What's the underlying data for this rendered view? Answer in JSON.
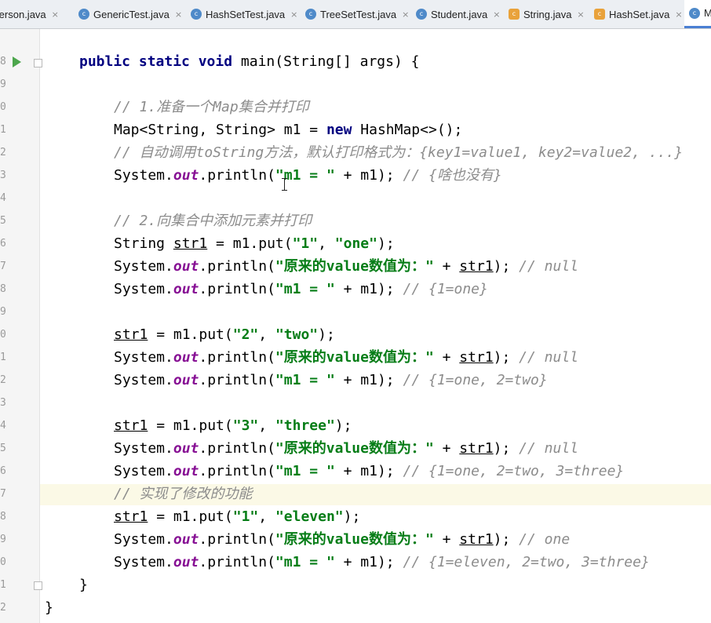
{
  "tabs": [
    {
      "label": "Person.java",
      "icon": "class-icon"
    },
    {
      "label": "GenericTest.java",
      "icon": "class-icon"
    },
    {
      "label": "HashSetTest.java",
      "icon": "class-icon"
    },
    {
      "label": "TreeSetTest.java",
      "icon": "class-icon"
    },
    {
      "label": "Student.java",
      "icon": "class-icon"
    },
    {
      "label": "String.java",
      "icon": "library-class-icon"
    },
    {
      "label": "HashSet.java",
      "icon": "library-class-icon"
    },
    {
      "label": "M",
      "icon": "class-icon",
      "active": true
    }
  ],
  "tab_close_glyph": "×",
  "line_numbers": [
    "8",
    "9",
    "0",
    "1",
    "2",
    "3",
    "4",
    "5",
    "6",
    "7",
    "8",
    "9",
    "0",
    "1",
    "2",
    "3",
    "4",
    "5",
    "6",
    "7",
    "8",
    "9",
    "0",
    "1",
    "2",
    "3"
  ],
  "code": {
    "l1": {
      "kw1": "public static void",
      "text": " main(String[] args) {"
    },
    "l2": {
      "comment": "// 1.准备一个Map集合并打印"
    },
    "l3": {
      "a": "Map<String, String> m1 = ",
      "kw": "new",
      "b": " HashMap<>();"
    },
    "l4": {
      "comment": "// 自动调用toString方法，默认打印格式为：{key1=value1, key2=value2, ...}"
    },
    "l5": {
      "a": "System.",
      "out": "out",
      "b": ".println(",
      "s": "\"m1 = \"",
      "c": " + m1); ",
      "comment": "// {啥也没有}"
    },
    "l6": {
      "comment": "// 2.向集合中添加元素并打印"
    },
    "l7": {
      "a": "String ",
      "var": "str1",
      "b": " = m1.put(",
      "s1": "\"1\"",
      "c": ", ",
      "s2": "\"one\"",
      "d": ");"
    },
    "l8": {
      "a": "System.",
      "out": "out",
      "b": ".println(",
      "s": "\"原来的value数值为：\"",
      "c": " + ",
      "var": "str1",
      "d": "); ",
      "comment": "// null"
    },
    "l9": {
      "a": "System.",
      "out": "out",
      "b": ".println(",
      "s": "\"m1 = \"",
      "c": " + m1); ",
      "comment": "// {1=one}"
    },
    "l10": {
      "var": "str1",
      "b": " = m1.put(",
      "s1": "\"2\"",
      "c": ", ",
      "s2": "\"two\"",
      "d": ");"
    },
    "l11": {
      "a": "System.",
      "out": "out",
      "b": ".println(",
      "s": "\"原来的value数值为：\"",
      "c": " + ",
      "var": "str1",
      "d": "); ",
      "comment": "// null"
    },
    "l12": {
      "a": "System.",
      "out": "out",
      "b": ".println(",
      "s": "\"m1 = \"",
      "c": " + m1); ",
      "comment": "// {1=one, 2=two}"
    },
    "l13": {
      "var": "str1",
      "b": " = m1.put(",
      "s1": "\"3\"",
      "c": ", ",
      "s2": "\"three\"",
      "d": ");"
    },
    "l14": {
      "a": "System.",
      "out": "out",
      "b": ".println(",
      "s": "\"原来的value数值为：\"",
      "c": " + ",
      "var": "str1",
      "d": "); ",
      "comment": "// null"
    },
    "l15": {
      "a": "System.",
      "out": "out",
      "b": ".println(",
      "s": "\"m1 = \"",
      "c": " + m1); ",
      "comment": "// {1=one, 2=two, 3=three}"
    },
    "l16": {
      "comment": "// 实现了修改的功能"
    },
    "l17": {
      "var": "str1",
      "b": " = m1.put(",
      "s1": "\"1\"",
      "c": ", ",
      "s2": "\"eleven\"",
      "d": ");"
    },
    "l18": {
      "a": "System.",
      "out": "out",
      "b": ".println(",
      "s": "\"原来的value数值为：\"",
      "c": " + ",
      "var": "str1",
      "d": "); ",
      "comment": "// one"
    },
    "l19": {
      "a": "System.",
      "out": "out",
      "b": ".println(",
      "s": "\"m1 = \"",
      "c": " + m1); ",
      "comment": "// {1=eleven, 2=two, 3=three}"
    },
    "l20": {
      "text": "}"
    },
    "l21": {
      "text": "}"
    }
  },
  "colors": {
    "keyword": "#000080",
    "string": "#067d17",
    "comment": "#8c8c8c",
    "static_field": "#871094",
    "run_icon": "#4ca64c",
    "current_line": "#fbf9e6"
  }
}
